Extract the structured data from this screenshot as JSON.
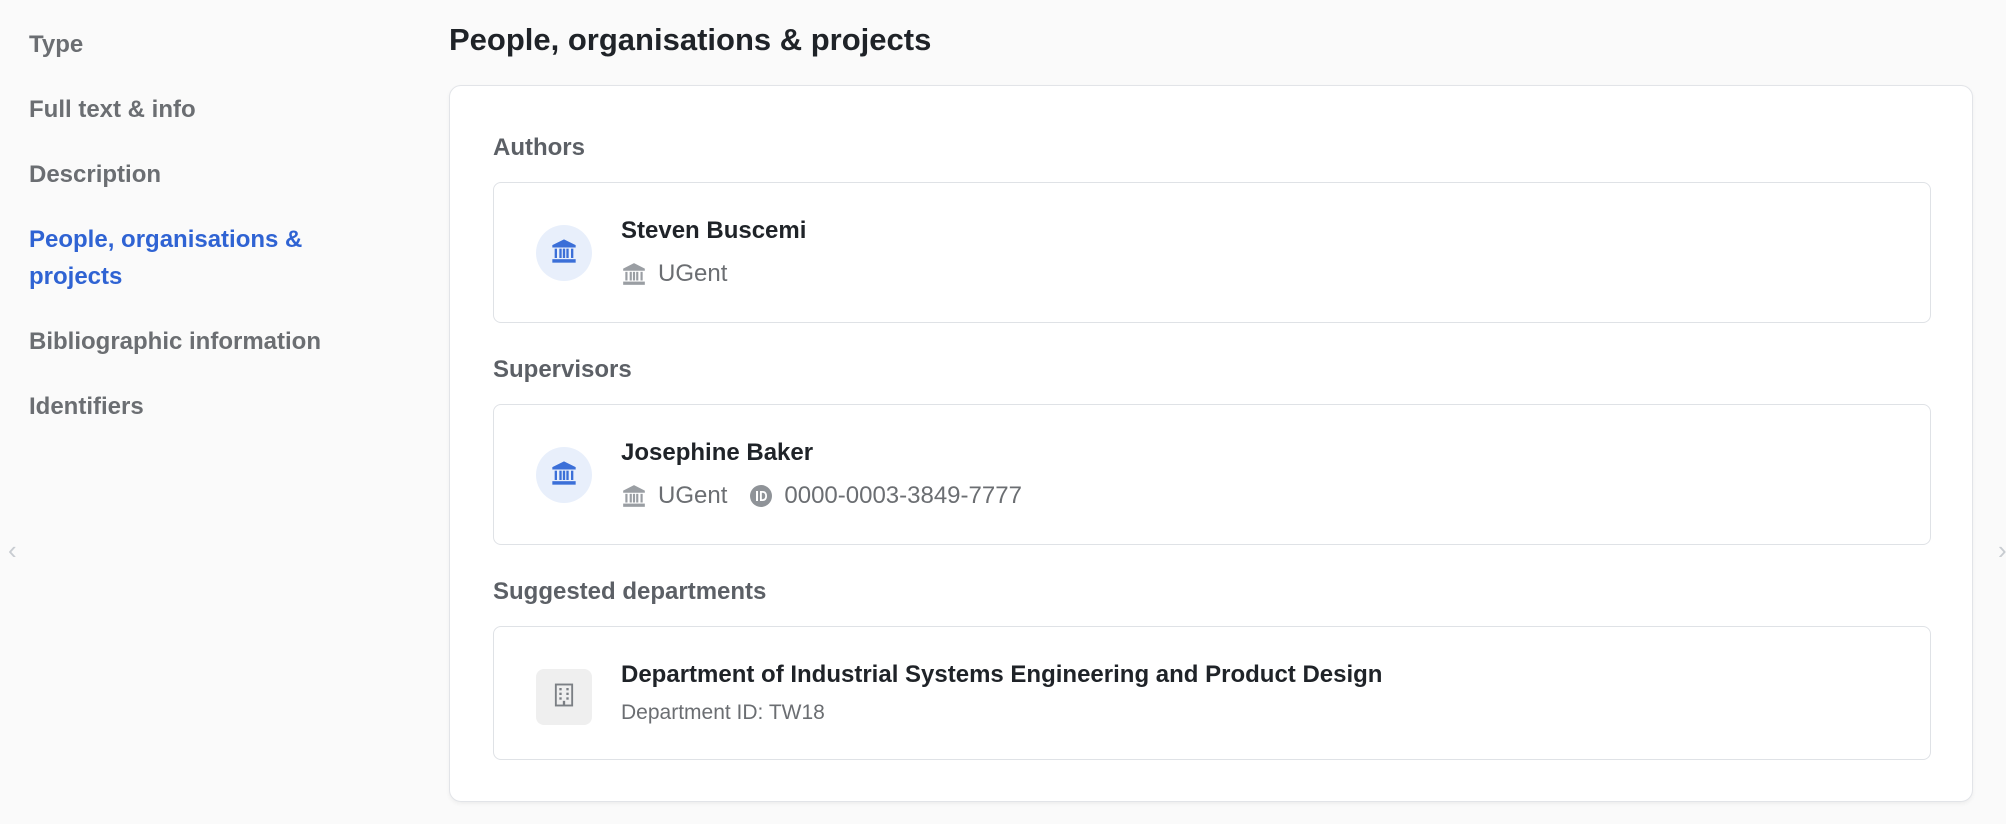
{
  "sidebar": {
    "items": [
      {
        "label": "Type"
      },
      {
        "label": "Full text & info"
      },
      {
        "label": "Description"
      },
      {
        "label": "People, organisations & projects"
      },
      {
        "label": "Bibliographic information"
      },
      {
        "label": "Identifiers"
      }
    ],
    "active_index": 3
  },
  "main": {
    "title": "People, organisations & projects",
    "authors": {
      "label": "Authors",
      "items": [
        {
          "name": "Steven Buscemi",
          "affiliation": "UGent",
          "avatar_icon": "institution-icon"
        }
      ]
    },
    "supervisors": {
      "label": "Supervisors",
      "items": [
        {
          "name": "Josephine Baker",
          "affiliation": "UGent",
          "orcid": "0000-0003-3849-7777",
          "avatar_icon": "institution-icon"
        }
      ]
    },
    "suggested_departments": {
      "label": "Suggested departments",
      "items": [
        {
          "name": "Department of Industrial Systems Engineering and Product Design",
          "department_id": "Department ID: TW18",
          "avatar_icon": "building-icon"
        }
      ]
    }
  },
  "colors": {
    "accent": "#2f63d3",
    "background": "#fafafa",
    "muted_text": "#6b6e72",
    "avatar_bg": "#e8effb"
  }
}
